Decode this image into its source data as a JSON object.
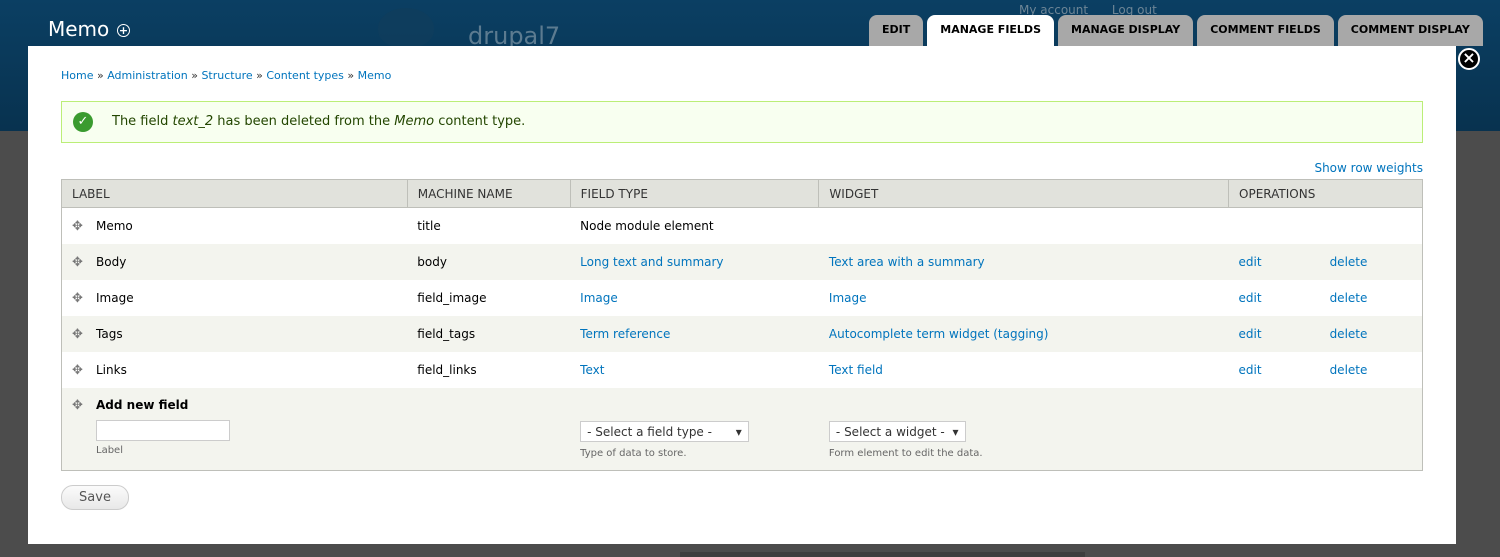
{
  "header": {
    "site_title": "Memo",
    "logo_text": "drupal7",
    "links": [
      "My account",
      "Log out"
    ],
    "tabs": [
      "EDIT",
      "MANAGE FIELDS",
      "MANAGE DISPLAY",
      "COMMENT FIELDS",
      "COMMENT DISPLAY"
    ],
    "active_tab": "MANAGE FIELDS"
  },
  "breadcrumb": [
    "Home",
    "Administration",
    "Structure",
    "Content types",
    "Memo"
  ],
  "breadcrumb_sep": "»",
  "status": {
    "prefix": "The field ",
    "field": "text_2",
    "middle": " has been deleted from the ",
    "type": "Memo",
    "suffix": " content type."
  },
  "show_row_weights": "Show row weights",
  "table": {
    "headers": [
      "LABEL",
      "MACHINE NAME",
      "FIELD TYPE",
      "WIDGET",
      "OPERATIONS"
    ],
    "rows": [
      {
        "label": "Memo",
        "machine": "title",
        "type": "Node module element",
        "widget": "",
        "edit": "",
        "delete": ""
      },
      {
        "label": "Body",
        "machine": "body",
        "type": "Long text and summary",
        "widget": "Text area with a summary",
        "edit": "edit",
        "delete": "delete"
      },
      {
        "label": "Image",
        "machine": "field_image",
        "type": "Image",
        "widget": "Image",
        "edit": "edit",
        "delete": "delete"
      },
      {
        "label": "Tags",
        "machine": "field_tags",
        "type": "Term reference",
        "widget": "Autocomplete term widget (tagging)",
        "edit": "edit",
        "delete": "delete"
      },
      {
        "label": "Links",
        "machine": "field_links",
        "type": "Text",
        "widget": "Text field",
        "edit": "edit",
        "delete": "delete"
      }
    ],
    "add_new": {
      "title": "Add new field",
      "label_desc": "Label",
      "type_select": "- Select a field type -",
      "type_desc": "Type of data to store.",
      "widget_select": "- Select a widget -",
      "widget_desc": "Form element to edit the data."
    }
  },
  "save_label": "Save"
}
